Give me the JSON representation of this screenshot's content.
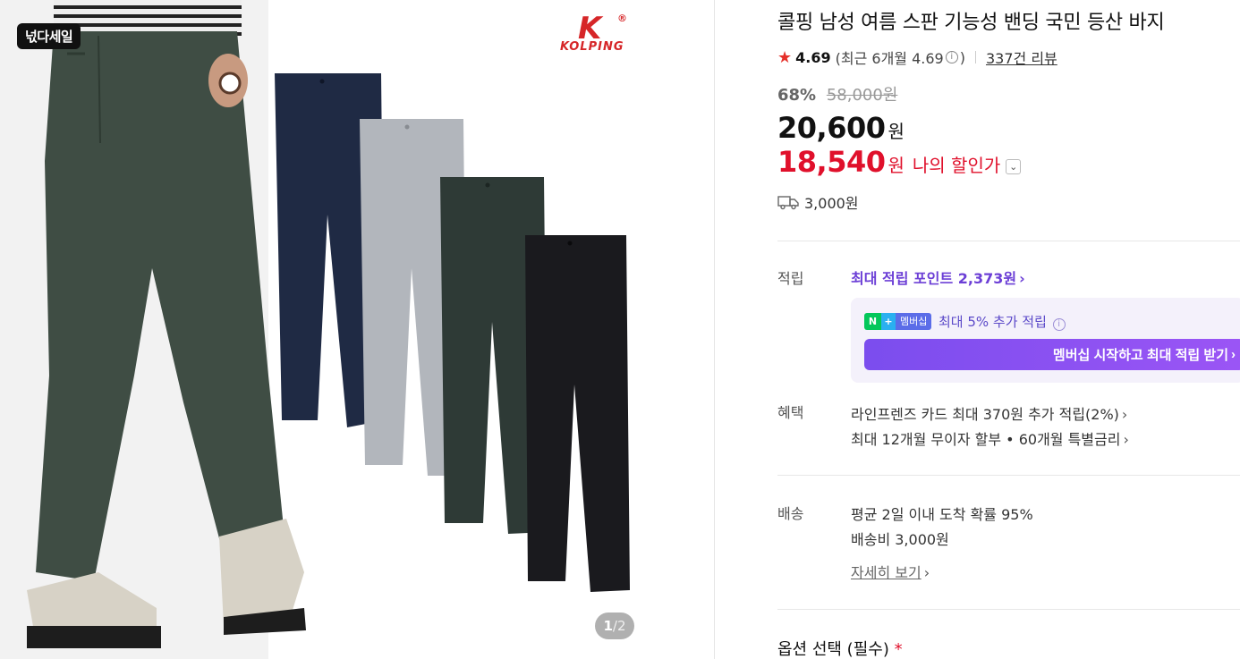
{
  "gallery": {
    "sale_badge": "넋다세일",
    "brand_letter": "K",
    "brand_mark": "®",
    "brand_name": "KOLPING",
    "pager_current": "1",
    "pager_total": "/2"
  },
  "product": {
    "title": "콜핑 남성 여름 스판 기능성 밴딩 국민 등산 바지",
    "rating": "4.69",
    "rating_recent": "(최근 6개월 4.69",
    "rating_recent_close": ")",
    "review_count": "337건 리뷰",
    "discount_rate": "68%",
    "original_price": "58,000원",
    "price": "20,600",
    "price_unit": "원",
    "my_price": "18,540",
    "my_price_unit": "원",
    "my_price_label": "나의 할인가",
    "shipping_fee": "3,000원"
  },
  "points": {
    "label": "적립",
    "max_points": "최대 적립 포인트 2,373원",
    "membership_badge": "멤버십",
    "membership_extra": "최대 5% 추가 적립",
    "membership_button": "멤버십 시작하고 최대 적립 받기"
  },
  "benefits": {
    "label": "혜택",
    "line1": "라인프렌즈 카드 최대 370원 추가 적립(2%)",
    "line2": "최대 12개월 무이자 할부 • 60개월 특별금리"
  },
  "delivery": {
    "label": "배송",
    "line1": "평균 2일 이내 도착 확률 95%",
    "line2": "배송비 3,000원",
    "detail_link": "자세히 보기"
  },
  "options": {
    "title": "옵션 선택 (필수)",
    "required_mark": "*"
  },
  "colors": {
    "accent_red": "#e0102b",
    "accent_purple": "#6c3fd6",
    "star": "#e5302a"
  }
}
